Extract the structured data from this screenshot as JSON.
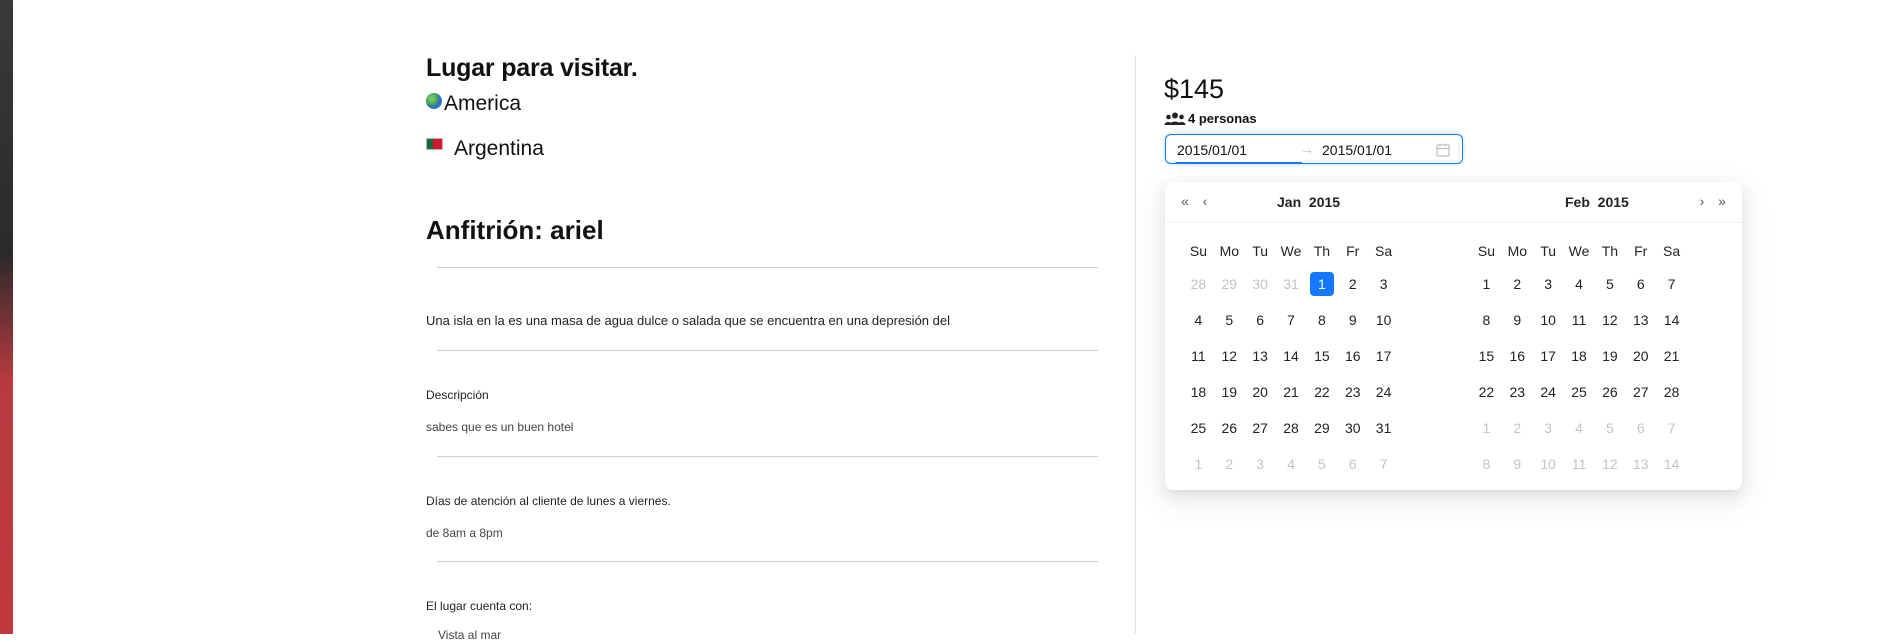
{
  "left": {
    "title": "Lugar para visitar.",
    "continent": "America",
    "country": "Argentina",
    "host": "Anfitrión: ariel",
    "summary": "Una isla en la es una masa de agua dulce o salada que se encuentra en una depresión del",
    "description_label": "Descripción",
    "description_value": "sabes que es un buen hotel",
    "service_label": "Días de atención al cliente de lunes a viernes.",
    "service_value": "de 8am a 8pm",
    "amenities_label": "El lugar cuenta con:",
    "amenities_first": "Vista al mar"
  },
  "booking": {
    "price": "$145",
    "persons": "4 personas",
    "start_date": "2015/01/01",
    "end_date": "2015/01/01",
    "range_arrow": "→"
  },
  "calendar": {
    "weekdays": [
      "Su",
      "Mo",
      "Tu",
      "We",
      "Th",
      "Fr",
      "Sa"
    ],
    "months": [
      {
        "month": "Jan",
        "year": "2015",
        "weeks": [
          [
            {
              "d": "28",
              "out": true
            },
            {
              "d": "29",
              "out": true
            },
            {
              "d": "30",
              "out": true
            },
            {
              "d": "31",
              "out": true
            },
            {
              "d": "1",
              "sel": true
            },
            {
              "d": "2"
            },
            {
              "d": "3"
            }
          ],
          [
            {
              "d": "4"
            },
            {
              "d": "5"
            },
            {
              "d": "6"
            },
            {
              "d": "7"
            },
            {
              "d": "8"
            },
            {
              "d": "9"
            },
            {
              "d": "10"
            }
          ],
          [
            {
              "d": "11"
            },
            {
              "d": "12"
            },
            {
              "d": "13"
            },
            {
              "d": "14"
            },
            {
              "d": "15"
            },
            {
              "d": "16"
            },
            {
              "d": "17"
            }
          ],
          [
            {
              "d": "18"
            },
            {
              "d": "19"
            },
            {
              "d": "20"
            },
            {
              "d": "21"
            },
            {
              "d": "22"
            },
            {
              "d": "23"
            },
            {
              "d": "24"
            }
          ],
          [
            {
              "d": "25"
            },
            {
              "d": "26"
            },
            {
              "d": "27"
            },
            {
              "d": "28"
            },
            {
              "d": "29"
            },
            {
              "d": "30"
            },
            {
              "d": "31"
            }
          ],
          [
            {
              "d": "1",
              "out": true
            },
            {
              "d": "2",
              "out": true
            },
            {
              "d": "3",
              "out": true
            },
            {
              "d": "4",
              "out": true
            },
            {
              "d": "5",
              "out": true
            },
            {
              "d": "6",
              "out": true
            },
            {
              "d": "7",
              "out": true
            }
          ]
        ]
      },
      {
        "month": "Feb",
        "year": "2015",
        "weeks": [
          [
            {
              "d": "1"
            },
            {
              "d": "2"
            },
            {
              "d": "3"
            },
            {
              "d": "4"
            },
            {
              "d": "5"
            },
            {
              "d": "6"
            },
            {
              "d": "7"
            }
          ],
          [
            {
              "d": "8"
            },
            {
              "d": "9"
            },
            {
              "d": "10"
            },
            {
              "d": "11"
            },
            {
              "d": "12"
            },
            {
              "d": "13"
            },
            {
              "d": "14"
            }
          ],
          [
            {
              "d": "15"
            },
            {
              "d": "16"
            },
            {
              "d": "17"
            },
            {
              "d": "18"
            },
            {
              "d": "19"
            },
            {
              "d": "20"
            },
            {
              "d": "21"
            }
          ],
          [
            {
              "d": "22"
            },
            {
              "d": "23"
            },
            {
              "d": "24"
            },
            {
              "d": "25"
            },
            {
              "d": "26"
            },
            {
              "d": "27"
            },
            {
              "d": "28"
            }
          ],
          [
            {
              "d": "1",
              "out": true
            },
            {
              "d": "2",
              "out": true
            },
            {
              "d": "3",
              "out": true
            },
            {
              "d": "4",
              "out": true
            },
            {
              "d": "5",
              "out": true
            },
            {
              "d": "6",
              "out": true
            },
            {
              "d": "7",
              "out": true
            }
          ],
          [
            {
              "d": "8",
              "out": true
            },
            {
              "d": "9",
              "out": true
            },
            {
              "d": "10",
              "out": true
            },
            {
              "d": "11",
              "out": true
            },
            {
              "d": "12",
              "out": true
            },
            {
              "d": "13",
              "out": true
            },
            {
              "d": "14",
              "out": true
            }
          ]
        ]
      }
    ],
    "nav": {
      "super_prev": "«",
      "prev": "‹",
      "next": "›",
      "super_next": "»"
    }
  },
  "colors": {
    "accent": "#1677ff",
    "sidebar_dark": "#2a2a2a",
    "sidebar_red": "#c0393e"
  },
  "icons": {
    "continent": "globe-icon",
    "country": "flag-icon",
    "persons": "users-icon",
    "date": "calendar-icon"
  }
}
